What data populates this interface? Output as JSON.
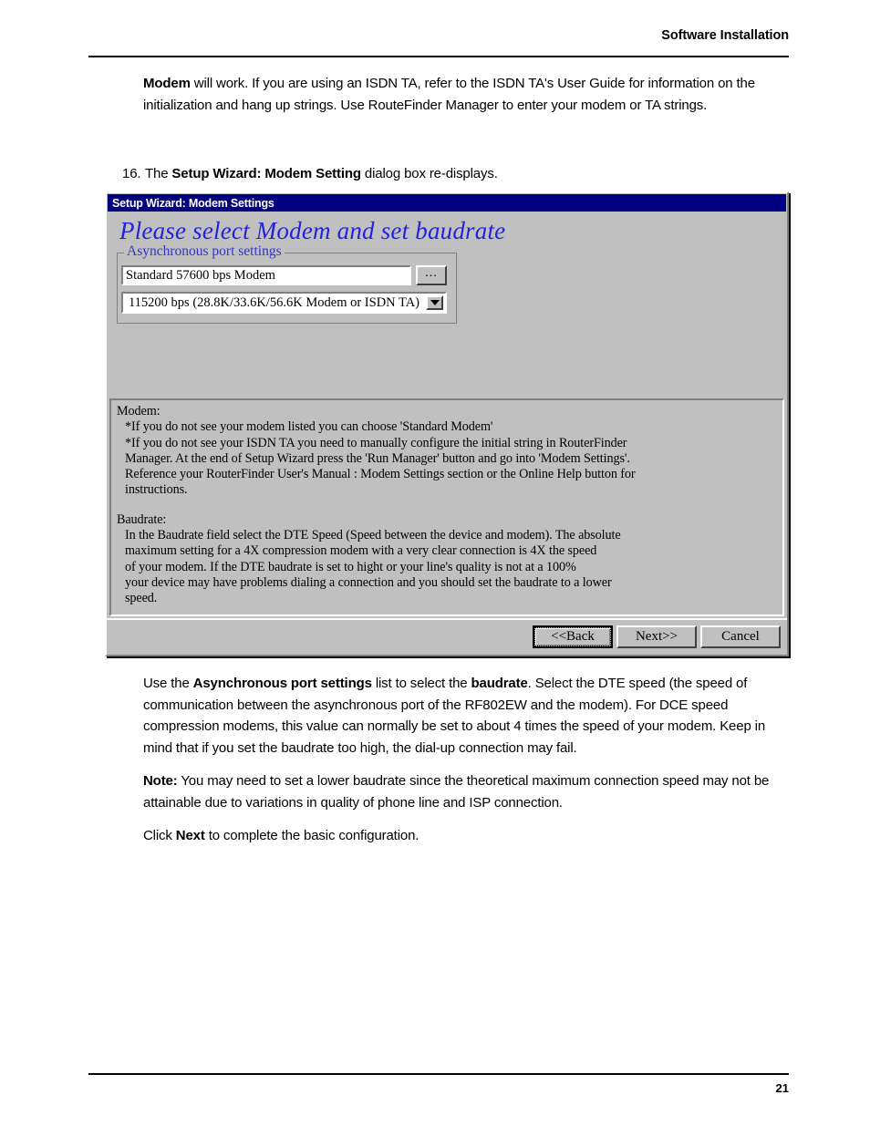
{
  "header": {
    "section_title": "Software Installation"
  },
  "intro_paragraph": {
    "lead_bold": "Modem",
    "rest": " will work.  If you are using an ISDN TA, refer to the ISDN TA's User Guide for information on the initialization and hang up strings.  Use RouteFinder Manager to enter your modem or TA strings."
  },
  "step": {
    "number": "16.",
    "prefix": "The ",
    "bold": "Setup Wizard: Modem Setting",
    "suffix": " dialog box re-displays."
  },
  "dialog": {
    "titlebar": "Setup Wizard: Modem Settings",
    "heading": "Please select Modem and set baudrate",
    "groupbox_legend": "Asynchronous port settings",
    "modem_field_value": "Standard 57600 bps Modem",
    "browse_button_label": "...",
    "baudrate_value": "115200 bps (28.8K/33.6K/56.6K Modem or ISDN TA)",
    "dropdown_icon": "chevron-down-icon",
    "help": {
      "modem_label": "Modem:",
      "modem_lines": [
        "*If you do not see your modem listed you can choose 'Standard Modem'",
        "*If you do not see your ISDN TA you need to manually configure the initial string in RouterFinder",
        "Manager.  At the end of Setup Wizard press the 'Run Manager' button and go into 'Modem Settings'.",
        "Reference your RouterFinder User's Manual : Modem Settings section or the Online Help button for",
        "instructions."
      ],
      "baudrate_label": "Baudrate:",
      "baudrate_lines": [
        "In the Baudrate field select the DTE Speed (Speed between the device and modem).  The absolute",
        "maximum setting for a 4X compression modem with a very clear connection is 4X the speed",
        "of your modem. If the DTE baudrate is set to hight or your line's quality is not at a 100%",
        "your device may have problems dialing a connection and you should set the baudrate to a lower",
        "speed."
      ]
    },
    "buttons": {
      "back": "<<Back",
      "next": "Next>>",
      "cancel": "Cancel"
    },
    "colors": {
      "titlebar_bg": "#000080",
      "face": "#c0c0c0",
      "heading_text": "#2222dd",
      "legend_text": "#3333cc"
    }
  },
  "body": {
    "para2": {
      "t1": "Use the ",
      "b1": "Asynchronous port settings",
      "t2": " list to select the ",
      "b2": "baudrate",
      "t3": ".  Select the DTE speed (the speed of communication between the asynchronous port of the RF802EW and the modem).  For DCE speed compression modems, this value can normally be set to about 4 times the speed of your modem.  Keep in mind that if you set the baudrate too high, the dial-up connection may fail."
    },
    "para3": {
      "b1": "Note:",
      "t1": " You may need to set a lower baudrate since the theoretical maximum connection speed may not be attainable due to variations in quality of phone line and ISP connection."
    },
    "para4": {
      "t1": "Click ",
      "b1": "Next",
      "t2": " to complete the basic configuration."
    }
  },
  "footer": {
    "page_number": "21"
  }
}
